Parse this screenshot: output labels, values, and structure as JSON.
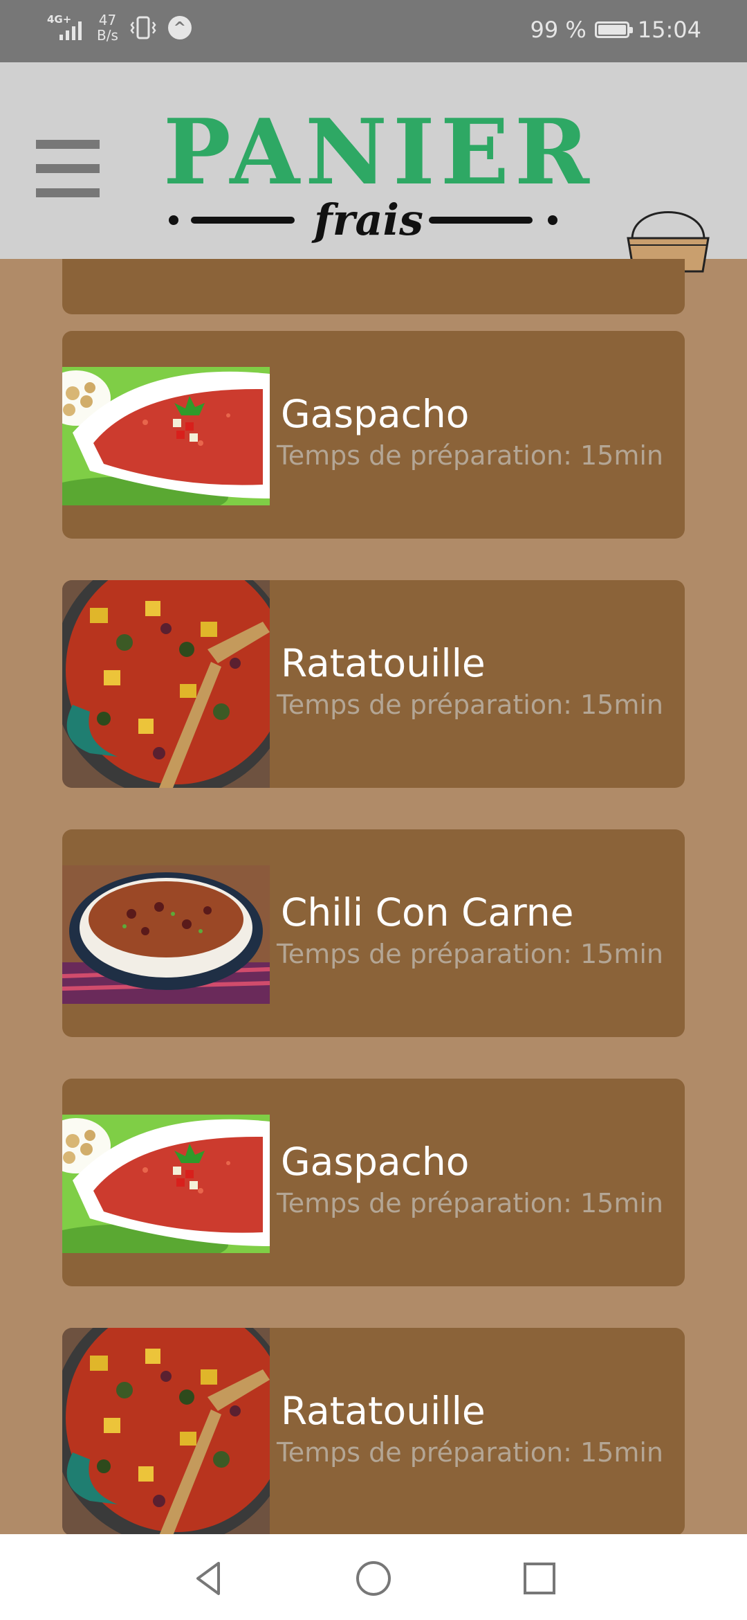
{
  "status_bar": {
    "network": "4G+",
    "speed_value": "47",
    "speed_unit": "B/s",
    "battery_text": "99 %",
    "battery_level": 0.99,
    "time": "15:04"
  },
  "header": {
    "logo_title": "PANIER",
    "logo_subtitle": "frais",
    "menu_icon": "hamburger-menu-icon",
    "basket_icon": "basket-icon"
  },
  "colors": {
    "background": "#b08b68",
    "card": "#8b6339",
    "header": "#d0d0d0",
    "logo_green": "#2ea864"
  },
  "recipes": [
    {
      "name": "",
      "prep_label": ""
    },
    {
      "name": "Gaspacho",
      "prep_label": "Temps de préparation: 15min",
      "image": "gaspacho"
    },
    {
      "name": "Ratatouille",
      "prep_label": "Temps de préparation: 15min",
      "image": "ratatouille"
    },
    {
      "name": "Chili Con Carne",
      "prep_label": "Temps de préparation: 15min",
      "image": "chili"
    },
    {
      "name": "Gaspacho",
      "prep_label": "Temps de préparation: 15min",
      "image": "gaspacho"
    },
    {
      "name": "Ratatouille",
      "prep_label": "Temps de préparation: 15min",
      "image": "ratatouille"
    }
  ],
  "nav": {
    "back_icon": "back-triangle-icon",
    "home_icon": "home-circle-icon",
    "recents_icon": "recents-square-icon"
  }
}
